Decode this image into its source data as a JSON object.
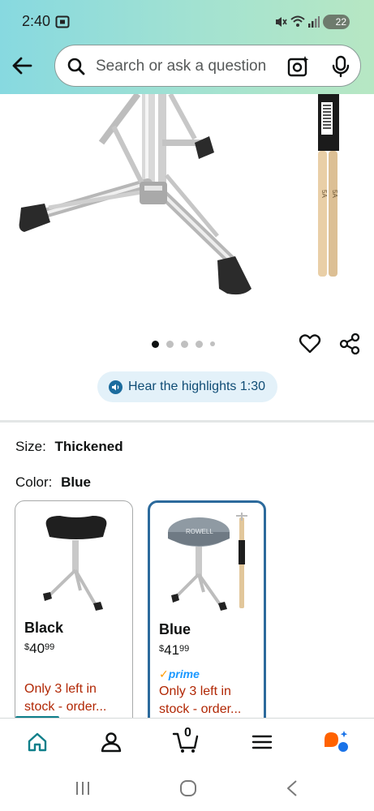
{
  "status_bar": {
    "time": "2:40",
    "battery": "22"
  },
  "search": {
    "placeholder": "Search or ask a question"
  },
  "gallery": {
    "image_count": 5,
    "active_index": 0
  },
  "highlights": {
    "label": "Hear the highlights 1:30"
  },
  "size": {
    "label": "Size:",
    "value": "Thickened"
  },
  "color": {
    "label": "Color:",
    "value": "Blue"
  },
  "options": [
    {
      "name": "Black",
      "price_currency": "$",
      "price_whole": "40",
      "price_fraction": "99",
      "stock": "Only 3 left in stock - order...",
      "selected": false,
      "prime": false
    },
    {
      "name": "Blue",
      "price_currency": "$",
      "price_whole": "41",
      "price_fraction": "99",
      "prime_label": "prime",
      "stock": "Only 3 left in stock - order...",
      "selected": true,
      "prime": true,
      "brand_text": "ROWELL"
    }
  ],
  "stick_text": "5A",
  "bottom_nav": {
    "cart_count": "0"
  },
  "colors": {
    "accent": "#2c6a9c",
    "stock": "#b12704",
    "prime": "#1a98ff",
    "header_start": "#87d9e0",
    "header_end": "#b7e7c3"
  }
}
